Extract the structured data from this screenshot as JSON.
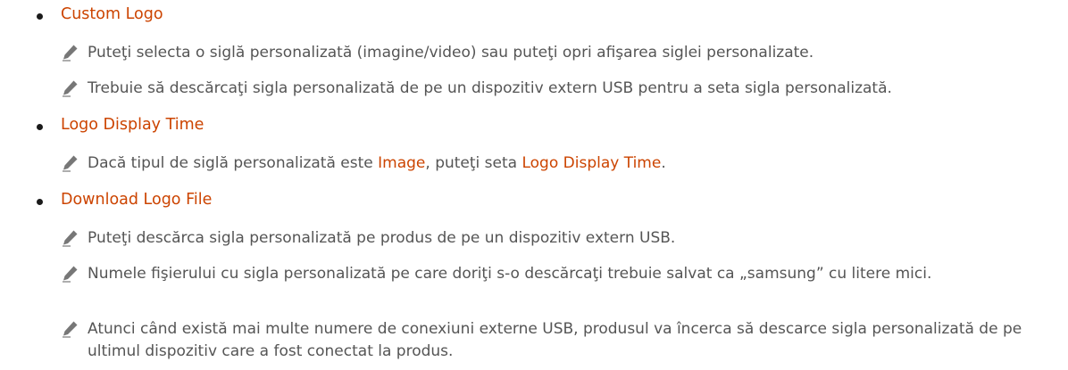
{
  "sections": [
    {
      "title": "Custom Logo",
      "notes": [
        {
          "text": "Puteţi selecta o siglă personalizată (imagine/video) sau puteţi opri afişarea siglei personalizate."
        },
        {
          "text": "Trebuie să descărcaţi sigla personalizată de pe un dispozitiv extern USB pentru a seta sigla personalizată."
        }
      ]
    },
    {
      "title": "Logo Display Time",
      "notes": [
        {
          "part1": "Dacă tipul de siglă personalizată este ",
          "link1": "Image",
          "part2": ", puteţi seta ",
          "link2": "Logo Display Time",
          "part3": "."
        }
      ]
    },
    {
      "title": "Download Logo File",
      "notes": [
        {
          "text": "Puteţi descărca sigla personalizată pe produs de pe un dispozitiv extern USB."
        },
        {
          "text": "Numele fişierului cu sigla personalizată pe care doriţi s-o descărcaţi trebuie salvat ca „samsung” cu litere mici."
        },
        {
          "text": "Atunci când există mai multe numere de conexiuni externe USB, produsul va încerca să descarce sigla personalizată de pe ultimul dispozitiv care a fost conectat la produs."
        }
      ]
    }
  ],
  "colors": {
    "accent": "#cc4400",
    "text": "#555555",
    "bullet": "#1a1a1a",
    "icon": "#777777"
  },
  "icons": {
    "note": "pencil-icon",
    "bullet": "bullet-dot"
  }
}
